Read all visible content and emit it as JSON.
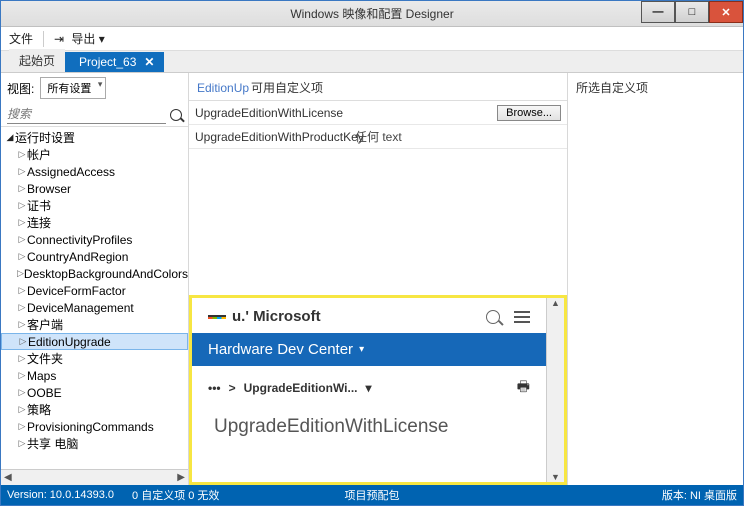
{
  "title": "Windows 映像和配置 Designer",
  "menu": {
    "file": "文件",
    "export": "导出",
    "export_arrow": "▾"
  },
  "tabs": {
    "start": "起始页",
    "project": "Project_63"
  },
  "left": {
    "viewLabel": "视图:",
    "viewDropdown": "所有设置",
    "searchPlaceholder": "搜索",
    "root": "运行时设置",
    "items": [
      "帐户",
      "AssignedAccess",
      "Browser",
      "证书",
      "连接",
      "ConnectivityProfiles",
      "CountryAndRegion",
      "DesktopBackgroundAndColors",
      "DeviceFormFactor",
      "DeviceManagement",
      "客户端",
      "EditionUpgrade",
      "文件夹",
      "Maps",
      "OOBE",
      "策略",
      "ProvisioningCommands",
      "共享 电脑"
    ],
    "selected": "EditionUpgrade"
  },
  "mid": {
    "crumbEdition": "EditionUp",
    "available": "可用自定义项",
    "row1": "UpgradeEditionWithLicense",
    "row1btn": "Browse...",
    "row2": "UpgradeEditionWithProductKey",
    "row2val": "任何 text"
  },
  "doc": {
    "msLabel": "u.' Microsoft",
    "blueTitle": "Hardware Dev Center",
    "bcItem": "UpgradeEditionWi...",
    "bigTitle": "UpgradeEditionWithLicense"
  },
  "right": {
    "hdr": "所选自定义项"
  },
  "status": {
    "ver": "Version: 10.0.14393.0",
    "cnt": "0 自定义项 0 无效",
    "mid": "项目预配包",
    "right": "版本: NI 桌面版"
  }
}
